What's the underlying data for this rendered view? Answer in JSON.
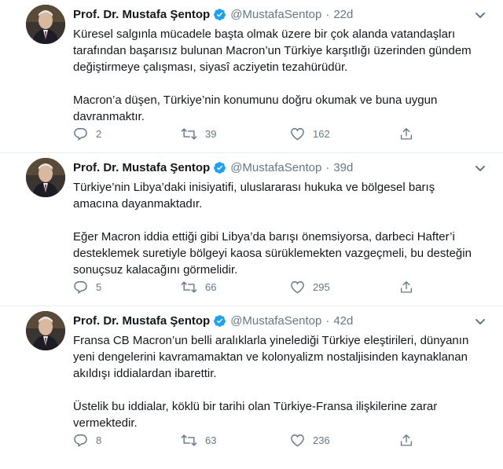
{
  "colors": {
    "text": "#14171a",
    "secondary": "#657786",
    "verified": "#1da1f2",
    "divider": "#e6ecf0"
  },
  "icons": {
    "reply": "reply-icon",
    "retweet": "retweet-icon",
    "like": "heart-icon",
    "share": "share-icon",
    "verified": "verified-badge-icon",
    "menu": "chevron-down-icon"
  },
  "tweets": [
    {
      "name": "Prof. Dr. Mustafa Şentop",
      "handle": "@MustafaSentop",
      "separator": "·",
      "time": "22d",
      "paragraphs": [
        "Küresel salgınla mücadele başta olmak üzere bir çok alanda vatandaşları tarafından başarısız bulunan Macron’un Türkiye karşıtlığı üzerinden gündem değiştirmeye çalışması, siyasî acziyetin tezahürüdür.",
        "Macron’a düşen, Türkiye’nin konumunu doğru okumak ve buna uygun davranmaktır."
      ],
      "replies": "2",
      "retweets": "39",
      "likes": "162"
    },
    {
      "name": "Prof. Dr. Mustafa Şentop",
      "handle": "@MustafaSentop",
      "separator": "·",
      "time": "39d",
      "paragraphs": [
        "Türkiye’nin Libya’daki inisiyatifi, uluslararası hukuka ve bölgesel barış amacına dayanmaktadır.",
        "Eğer Macron iddia ettiği gibi Libya’da barışı önemsiyorsa, darbeci Hafter’i desteklemek suretiyle bölgeyi kaosa sürüklemekten vazgeçmeli, bu desteğin sonuçsuz kalacağını görmelidir."
      ],
      "replies": "5",
      "retweets": "66",
      "likes": "295"
    },
    {
      "name": "Prof. Dr. Mustafa Şentop",
      "handle": "@MustafaSentop",
      "separator": "·",
      "time": "42d",
      "paragraphs": [
        "Fransa CB Macron’un belli aralıklarla yinelediği Türkiye eleştirileri, dünyanın yeni dengelerini kavramamaktan ve kolonyalizm nostaljisinden kaynaklanan akıldışı iddialardan ibarettir.",
        "Üstelik bu iddialar, köklü bir tarihi olan Türkiye-Fransa ilişkilerine zarar vermektedir."
      ],
      "replies": "8",
      "retweets": "63",
      "likes": "236"
    }
  ]
}
